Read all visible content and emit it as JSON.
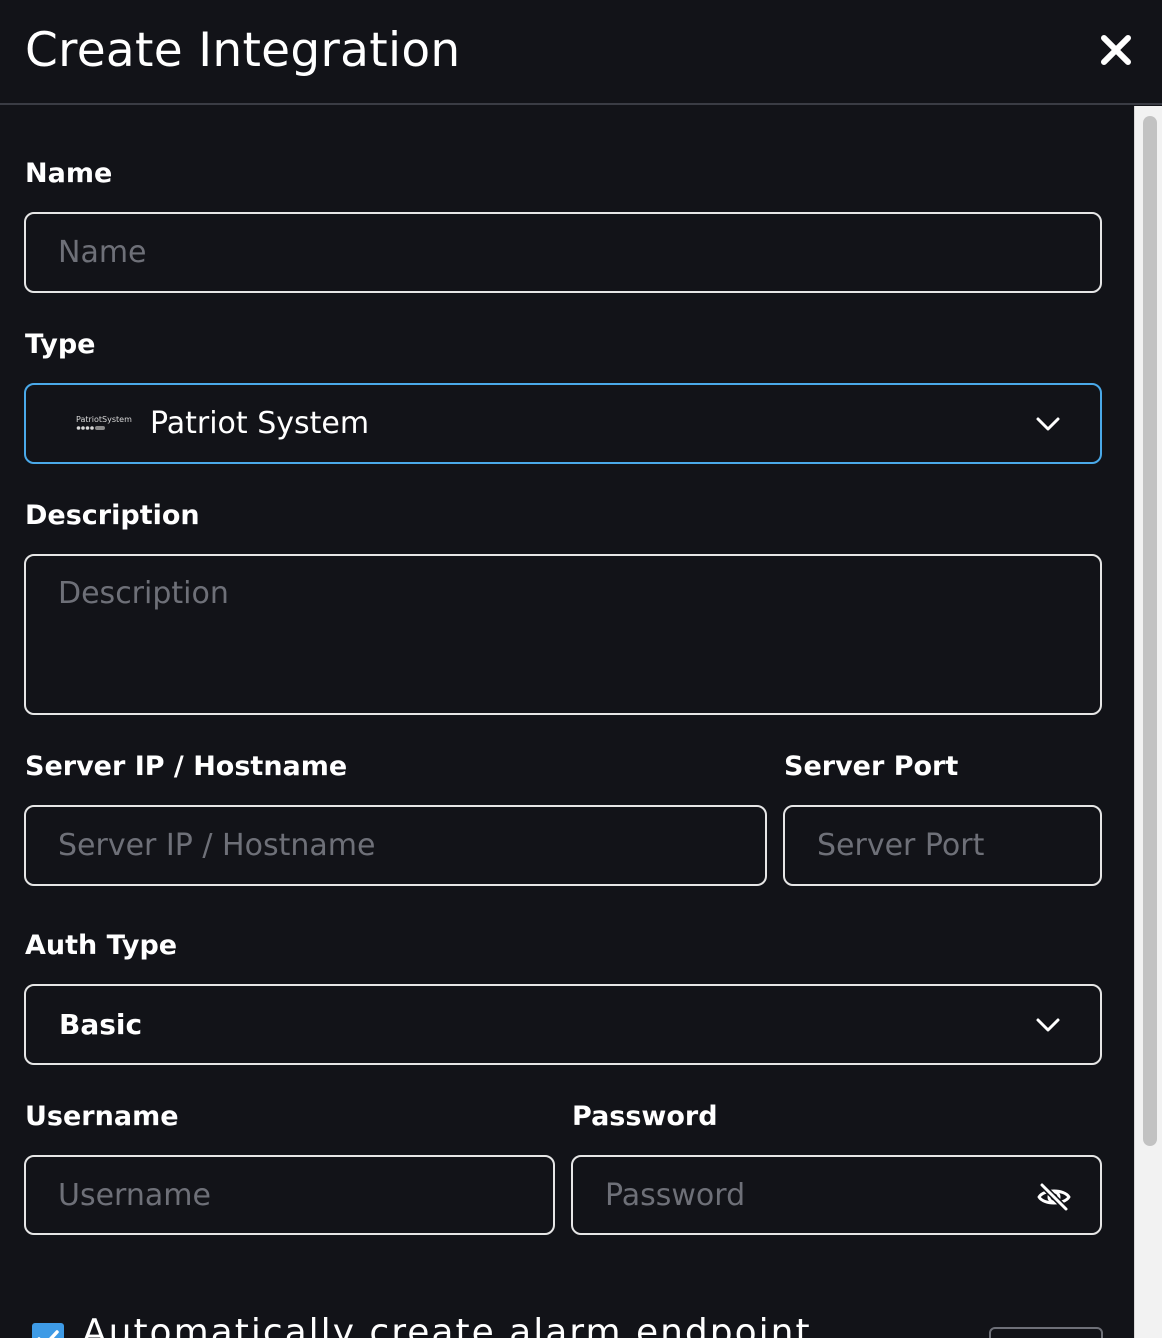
{
  "dialog": {
    "title": "Create Integration"
  },
  "form": {
    "name": {
      "label": "Name",
      "placeholder": "Name"
    },
    "type": {
      "label": "Type",
      "logo_text": "PatriotSystems",
      "value": "Patriot System"
    },
    "description": {
      "label": "Description",
      "placeholder": "Description"
    },
    "server_host": {
      "label": "Server IP / Hostname",
      "placeholder": "Server IP / Hostname"
    },
    "server_port": {
      "label": "Server Port",
      "placeholder": "Server Port"
    },
    "auth_type": {
      "label": "Auth Type",
      "value": "Basic"
    },
    "username": {
      "label": "Username",
      "placeholder": "Username"
    },
    "password": {
      "label": "Password",
      "placeholder": "Password"
    },
    "auto_create": {
      "label": "Automatically create alarm endpoint",
      "checked": true
    }
  },
  "colors": {
    "background": "#121318",
    "focus_border": "#4aa9e9",
    "checkbox": "#3e9be6",
    "placeholder": "#6e7078"
  },
  "icons": {
    "close": "close-icon",
    "chevron": "chevron-down-icon",
    "eye": "eye-off-icon",
    "check": "check-icon"
  }
}
